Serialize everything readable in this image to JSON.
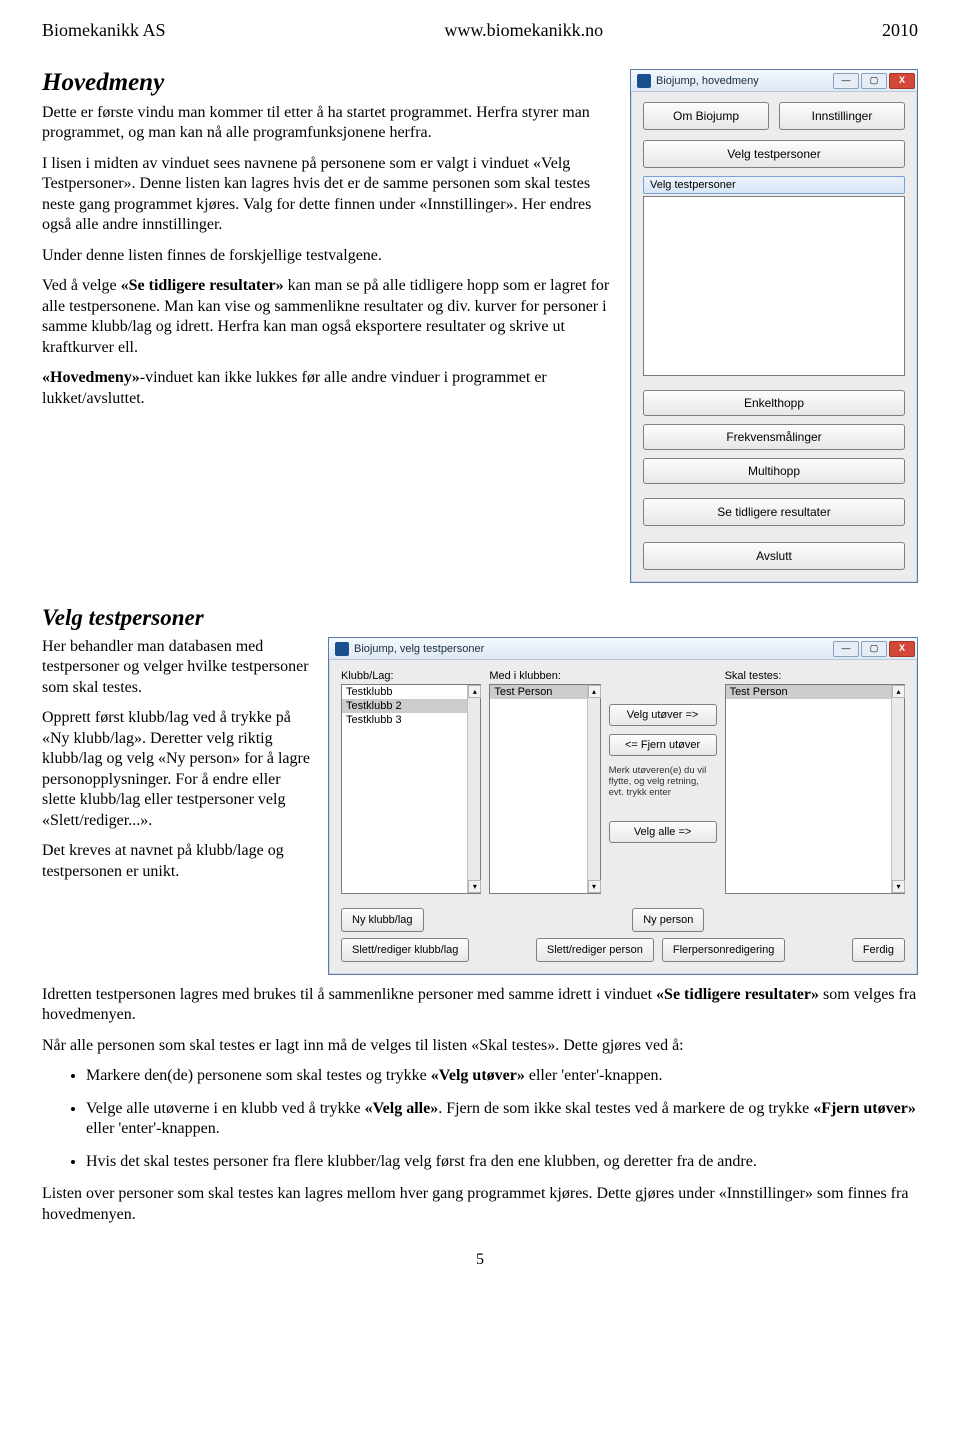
{
  "header": {
    "company": "Biomekanikk AS",
    "url": "www.biomekanikk.no",
    "year": "2010"
  },
  "hovedmeny_text": {
    "title": "Hovedmeny",
    "p1": "Dette er første vindu man kommer til etter å ha startet programmet. Herfra styrer man programmet, og man kan nå alle programfunksjonene herfra.",
    "p2": "I lisen i midten av vinduet sees navnene på personene som er valgt i vinduet «Velg Testpersoner». Denne listen kan lagres hvis det er de samme personen som skal testes neste gang programmet kjøres. Valg for dette finnen under «Innstillinger». Her endres også alle andre innstillinger.",
    "p3": "Under denne listen finnes de forskjellige testvalgene.",
    "p4a": "Ved å velge ",
    "p4b": "«Se tidligere resultater»",
    "p4c": " kan man se på alle tidligere hopp som er lagret for alle testpersonene. Man kan vise og sammenlikne resultater og div. kurver for personer i samme klubb/lag og idrett. Herfra kan man også eksportere resultater og skrive ut kraftkurver ell.",
    "p5a": "«Hovedmeny»",
    "p5b": "-vinduet kan ikke lukkes før alle andre vinduer i programmet er lukket/avsluttet."
  },
  "hovedmeny_win": {
    "title": "Biojump, hovedmeny",
    "btn_om": "Om Biojump",
    "btn_innst": "Innstillinger",
    "btn_velg": "Velg testpersoner",
    "list_label": "Velg testpersoner",
    "btn_enkel": "Enkelthopp",
    "btn_frekv": "Frekvensmålinger",
    "btn_multi": "Multihopp",
    "btn_se": "Se tidligere resultater",
    "btn_avslutt": "Avslutt"
  },
  "velg_text": {
    "title": "Velg testpersoner",
    "p1": "Her behandler man databasen med testpersoner og velger hvilke testpersoner som skal testes.",
    "p2": "Opprett først klubb/lag ved å trykke på «Ny klubb/lag». Deretter velg riktig klubb/lag og velg «Ny person» for å lagre personopplysninger. For å endre eller slette klubb/lag eller testpersoner velg «Slett/rediger...».",
    "p3": "Det kreves at navnet på klubb/lage og testpersonen er unikt."
  },
  "vt_win": {
    "title": "Biojump, velg testpersoner",
    "klubb_label": "Klubb/Lag:",
    "med_label": "Med i klubben:",
    "skal_label": "Skal testes:",
    "klubb_items": [
      "Testklubb",
      "Testklubb 2",
      "Testklubb 3"
    ],
    "klubb_selected": "Testklubb 2",
    "med_items": [
      "Test Person"
    ],
    "med_selected": "Test Person",
    "skal_items": [
      "Test Person"
    ],
    "skal_selected": "Test Person",
    "btn_velg_ut": "Velg utøver =>",
    "btn_fjern": "<= Fjern utøver",
    "hint": "Merk utøveren(e) du vil flytte, og velg retning, evt. trykk enter",
    "btn_velg_alle": "Velg alle =>",
    "btn_ny_klubb": "Ny klubb/lag",
    "btn_ny_person": "Ny person",
    "btn_sr_klubb": "Slett/rediger klubb/lag",
    "btn_sr_person": "Slett/rediger person",
    "btn_fler": "Flerpersonredigering",
    "btn_ferdig": "Ferdig"
  },
  "bottom": {
    "p1a": "Idretten testpersonen lagres med brukes til å sammenlikne personer med samme idrett i vinduet ",
    "p1b": "«Se tidligere resultater»",
    "p1c": " som velges fra hovedmenyen.",
    "p2": "Når alle personen som skal testes er lagt inn må de velges til listen «Skal testes». Dette gjøres ved å:",
    "li1a": "Markere den(de) personene som skal testes og trykke ",
    "li1b": "«Velg utøver»",
    "li1c": " eller 'enter'-knappen.",
    "li2a": "Velge alle utøverne i en klubb ved å trykke ",
    "li2b": "«Velg alle»",
    "li2c": ". Fjern de som ikke skal testes ved å markere de og trykke ",
    "li2d": "«Fjern utøver»",
    "li2e": " eller 'enter'-knappen.",
    "li3": "Hvis det skal testes personer fra flere klubber/lag velg først fra den ene klubben, og deretter fra de andre.",
    "p3": "Listen over personer som skal testes kan lagres mellom hver gang programmet kjøres. Dette gjøres under «Innstillinger» som finnes fra hovedmenyen.",
    "page": "5"
  }
}
